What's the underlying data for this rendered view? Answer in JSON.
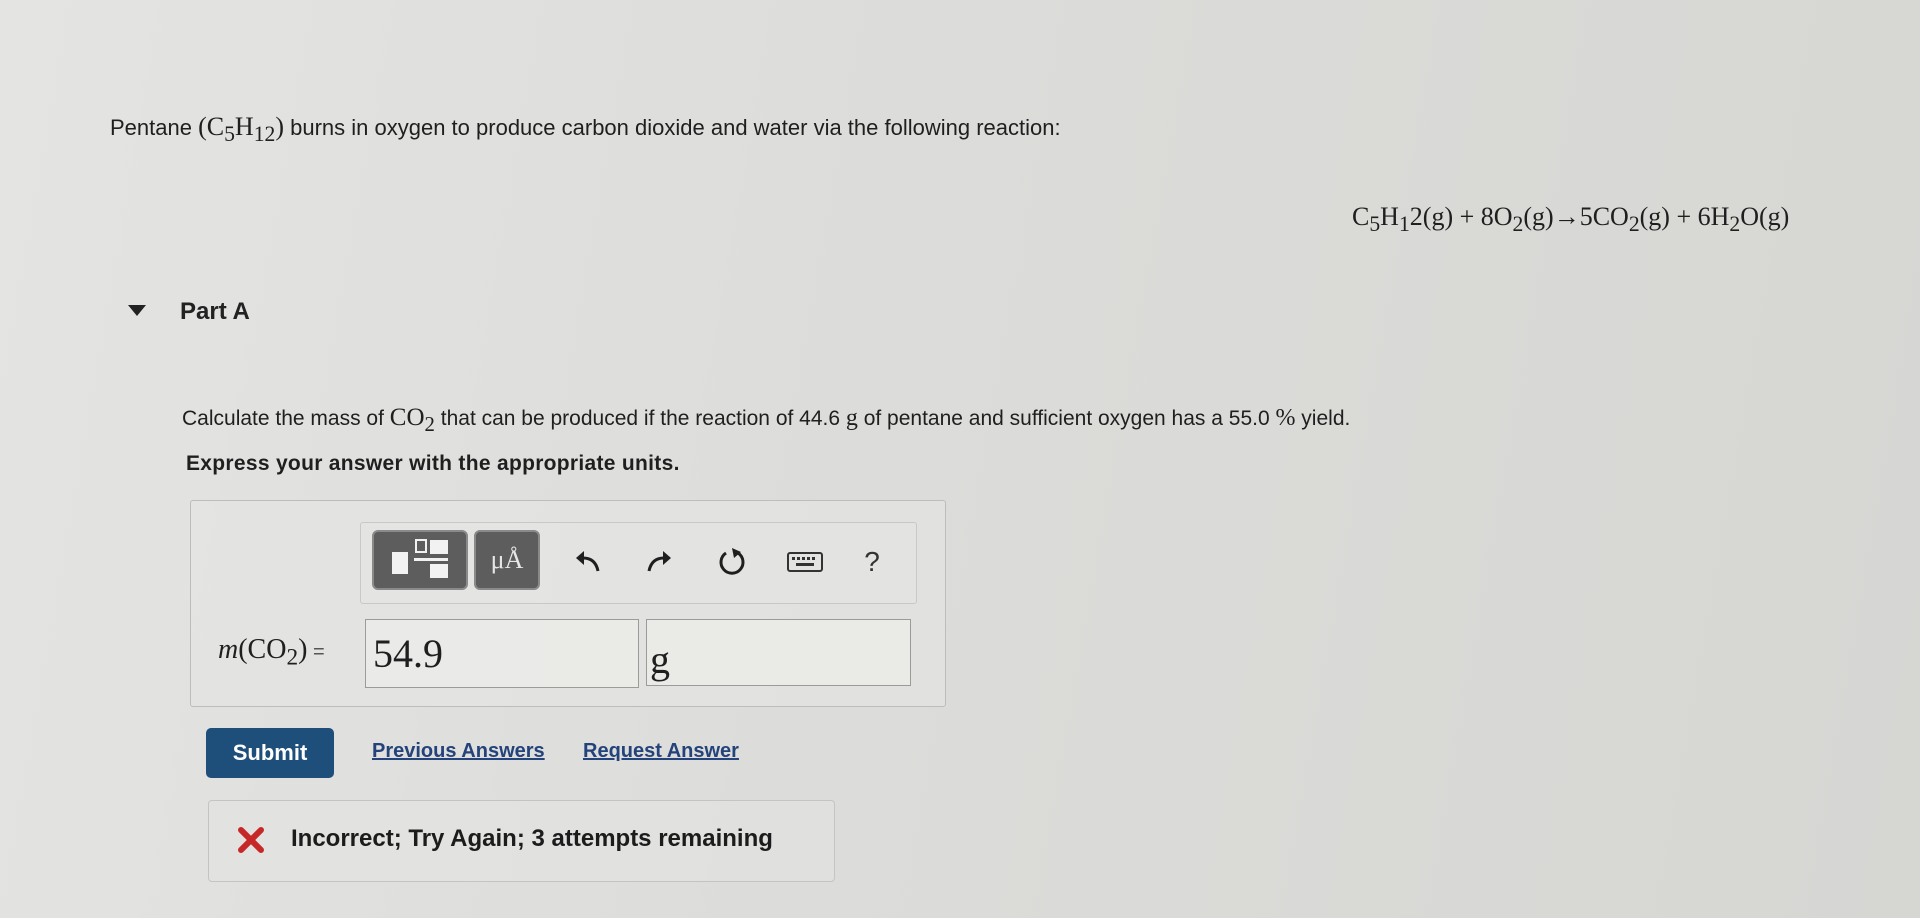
{
  "problem": {
    "intro_before": "Pentane ",
    "intro_formula_open": "(C",
    "intro_formula_sub1": "5",
    "intro_formula_mid": "H",
    "intro_formula_sub2": "12",
    "intro_formula_close": ")",
    "intro_after": " burns in oxygen to produce carbon dioxide and water via the following reaction:",
    "equation": {
      "p1": "C",
      "s1": "5",
      "p2": "H",
      "s2": "1",
      "p3": "2(g) + 8O",
      "s3": "2",
      "p4": "(g)→5CO",
      "s4": "2",
      "p5": "(g) + 6H",
      "s5": "2",
      "p6": "O(g)"
    }
  },
  "part": {
    "title": "Part A",
    "question_before": "Calculate the mass of ",
    "question_co": "CO",
    "question_sub": "2",
    "question_after_1": " that can be produced if the reaction of 44.6 ",
    "question_unit_g": "g",
    "question_after_2": " of pentane and sufficient oxygen has a 55.0 ",
    "question_pct": "%",
    "question_after_3": " yield.",
    "instructions": "Express your answer with the appropriate units."
  },
  "toolbar": {
    "units_label": "μÅ",
    "help_label": "?",
    "icons": [
      "templates-icon",
      "units-icon",
      "undo-icon",
      "redo-icon",
      "reset-icon",
      "keyboard-icon",
      "help-icon"
    ]
  },
  "answer": {
    "label_m": "m",
    "label_open": "(CO",
    "label_sub": "2",
    "label_close": ")",
    "label_eq": " = ",
    "value": "54.9",
    "units": "g"
  },
  "actions": {
    "submit": "Submit",
    "previous_answers": "Previous Answers",
    "request_answer": "Request Answer"
  },
  "feedback": {
    "message": "Incorrect; Try Again; 3 attempts remaining",
    "status_color": "#c62828"
  },
  "colors": {
    "submit_bg": "#1e4e7a",
    "link": "#24437a",
    "toolbar_button": "#5d5d5d"
  }
}
